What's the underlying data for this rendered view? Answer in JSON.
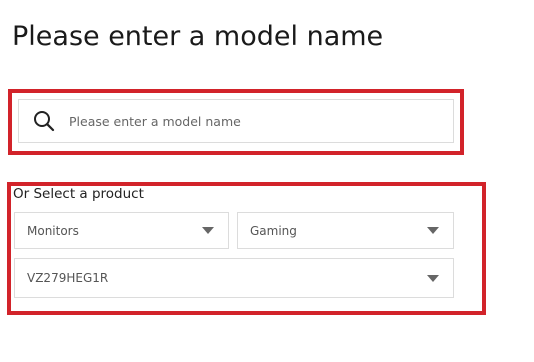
{
  "page": {
    "title": "Please enter a model name"
  },
  "search": {
    "placeholder": "Please enter a model name",
    "icon": "search-icon"
  },
  "selector": {
    "label": "Or Select a product",
    "category": {
      "value": "Monitors"
    },
    "series": {
      "value": "Gaming"
    },
    "model": {
      "value": "VZ279HEG1R"
    }
  },
  "colors": {
    "highlight": "#d2232a",
    "border": "#dcdcdc"
  }
}
